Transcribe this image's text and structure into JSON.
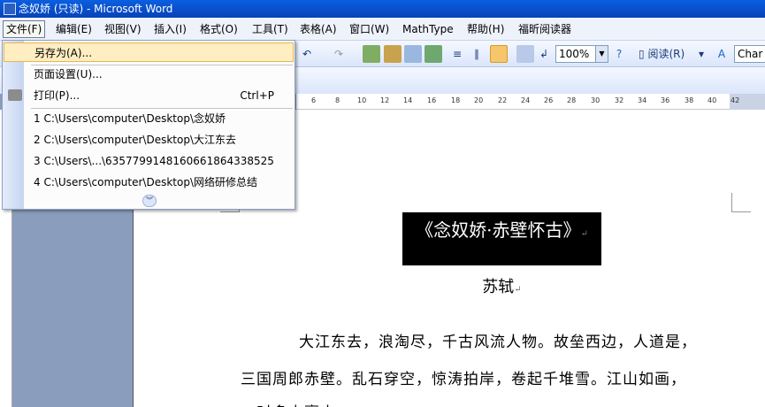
{
  "window": {
    "title": "念奴娇 (只读) - Microsoft Word"
  },
  "menubar": {
    "items": [
      "文件(F)",
      "编辑(E)",
      "视图(V)",
      "插入(I)",
      "格式(O)",
      "工具(T)",
      "表格(A)",
      "窗口(W)",
      "MathType",
      "帮助(H)",
      "福昕阅读器"
    ]
  },
  "toolbar": {
    "zoom": "100%",
    "read_label": "阅读(R)",
    "style": "Char"
  },
  "ruler": {
    "ticks": [
      "6",
      "8",
      "10",
      "12",
      "14",
      "16",
      "18",
      "20",
      "22",
      "24",
      "26",
      "28",
      "30",
      "32",
      "34",
      "36",
      "38",
      "40",
      "42"
    ]
  },
  "file_menu": {
    "save_as": "另存为(A)...",
    "page_setup": "页面设置(U)...",
    "print": "打印(P)...",
    "print_shortcut": "Ctrl+P",
    "recent": [
      "1 C:\\Users\\computer\\Desktop\\念奴娇",
      "2 C:\\Users\\computer\\Desktop\\大江东去",
      "3 C:\\Users\\...\\635779914816066186433852​5",
      "4 C:\\Users\\computer\\Desktop\\网络研修总结"
    ]
  },
  "document": {
    "title": "《念奴娇·赤壁怀古》",
    "author": "苏轼",
    "lines": [
      "大江东去，浪淘尽，千古风流人物。故垒西边，人道是，",
      "三国周郎赤壁。乱石穿空，惊涛拍岸，卷起千堆雪。江山如画，",
      "一时多少豪杰。"
    ]
  }
}
